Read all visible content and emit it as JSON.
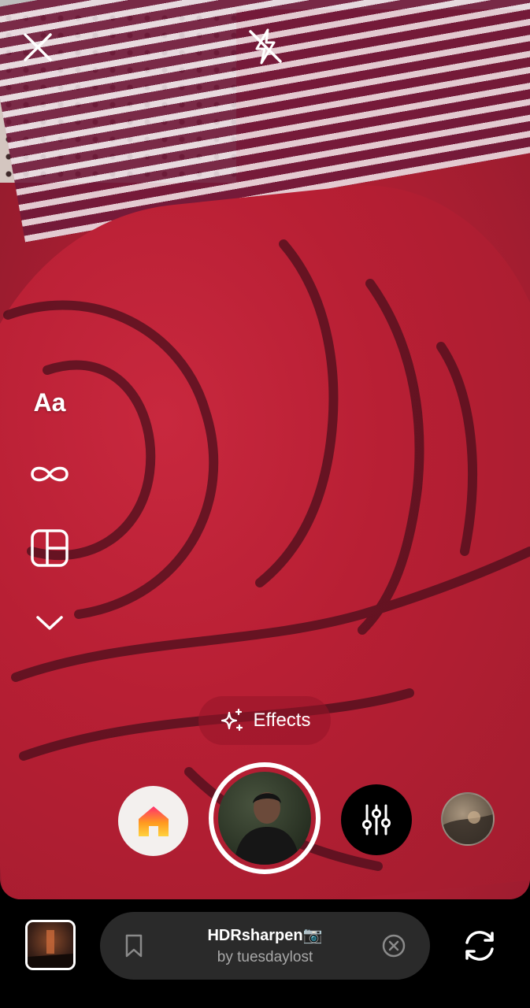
{
  "camera": {
    "close_icon": "close-icon",
    "flash_icon": "flash-off-icon"
  },
  "tools": {
    "text_label": "Aa",
    "boomerang_icon": "infinity-icon",
    "layout_icon": "layout-grid-icon",
    "more_icon": "chevron-down-icon"
  },
  "effects": {
    "label": "Effects",
    "icon": "sparkles-icon"
  },
  "carousel": {
    "home_icon": "home-icon",
    "adjust_icon": "sliders-icon"
  },
  "selected_effect": {
    "name": "HDRsharpen📷",
    "creator": "by tuesdaylost",
    "save_icon": "bookmark-icon",
    "remove_icon": "close-circle-icon"
  },
  "bottom": {
    "flip_icon": "flip-camera-icon"
  },
  "colors": {
    "accent_red": "#b81f34",
    "pill_bg": "#2a2a2a",
    "home_gradient": [
      "#ff2f6e",
      "#ff9a1f",
      "#ffd23f"
    ]
  }
}
